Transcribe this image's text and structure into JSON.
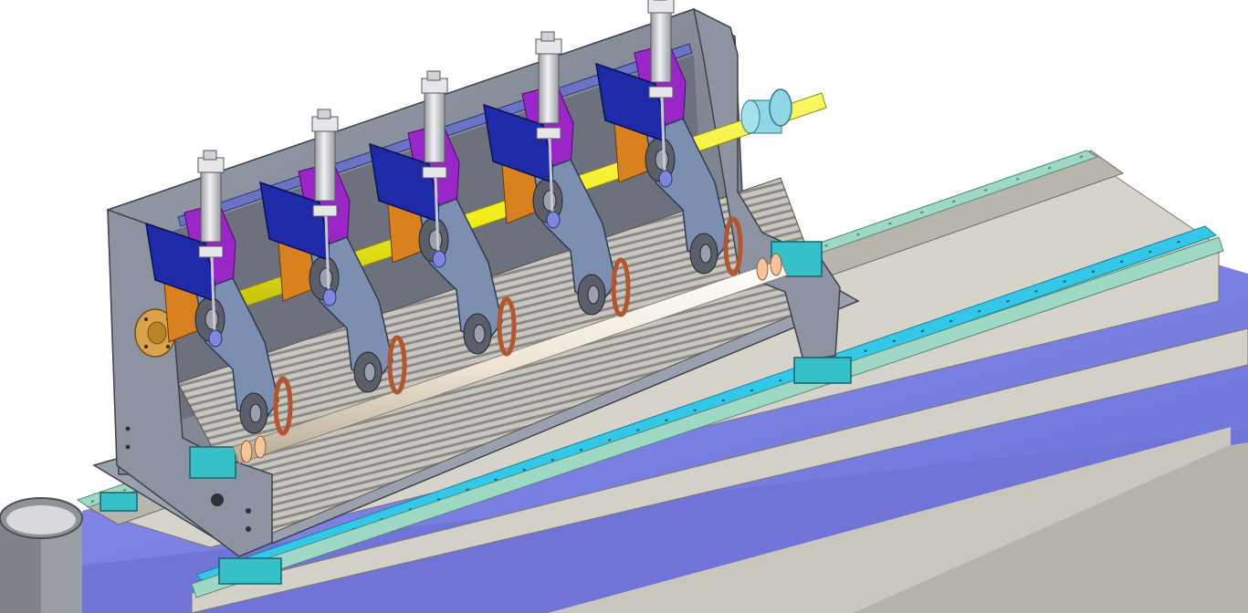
{
  "scene": {
    "subject": "",
    "modules": [
      {
        "id": "module-1"
      },
      {
        "id": "module-2"
      },
      {
        "id": "module-3"
      },
      {
        "id": "module-4"
      },
      {
        "id": "module-5"
      }
    ],
    "colors": {
      "background": "#ffffff",
      "frame_gray": "#8a8f9c",
      "frame_dark": "#4a4e58",
      "base_gray": "#b9b6ae",
      "base_light": "#d8d5cd",
      "deck_blue": "#7d84e6",
      "deck_blue_dark": "#5b61c8",
      "rail_green": "#9fd8c4",
      "rail_cyan": "#34c8e8",
      "shaft_yellow": "#f2ee1a",
      "cover_blue": "#1e2aa8",
      "bracket_purple": "#9b26c8",
      "plate_orange": "#d9801f",
      "arm_steel": "#7d8fb0",
      "cylinder_silver": "#d4d6da",
      "roller_beige": "#efe6d6",
      "blade_copper": "#b4552c",
      "flange_gold": "#d9a34a",
      "bearing_teal": "#38c0c8"
    }
  }
}
